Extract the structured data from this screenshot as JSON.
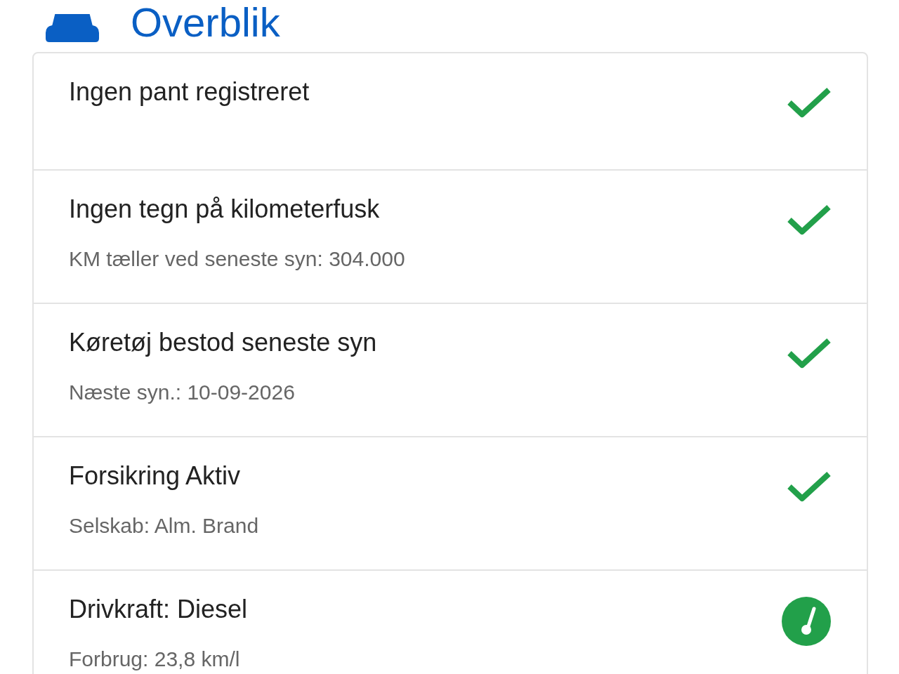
{
  "header": {
    "title": "Overblik"
  },
  "items": [
    {
      "title": "Ingen pant registreret",
      "kind": "check"
    },
    {
      "title": "Ingen tegn på kilometerfusk",
      "detail": "KM tæller ved seneste syn: 304.000",
      "kind": "check"
    },
    {
      "title": "Køretøj bestod seneste syn",
      "detail": "Næste syn.: 10-09-2026",
      "kind": "check"
    },
    {
      "title": "Forsikring Aktiv",
      "detail": "Selskab: Alm. Brand",
      "kind": "check"
    },
    {
      "title": "Drivkraft: Diesel",
      "detail": "Forbrug: 23,8 km/l",
      "kind": "gauge"
    }
  ]
}
